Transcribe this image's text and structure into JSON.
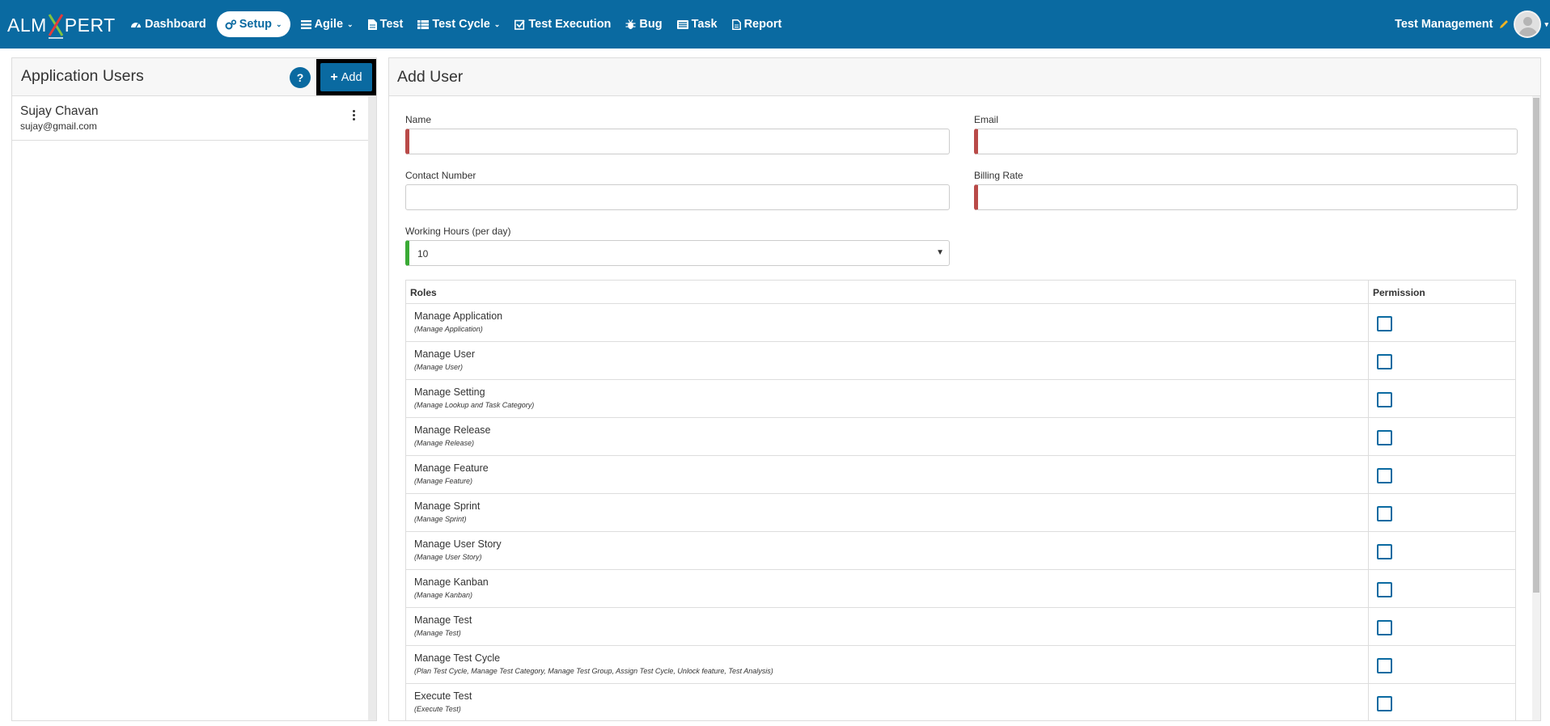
{
  "brand": {
    "prefix": "ALM",
    "suffix": "PERT"
  },
  "nav": [
    {
      "label": "Dashboard",
      "icon": "dashboard-icon"
    },
    {
      "label": "Setup",
      "icon": "cogs-icon",
      "dropdown": true,
      "active": true
    },
    {
      "label": "Agile",
      "icon": "list-icon",
      "dropdown": true
    },
    {
      "label": "Test",
      "icon": "file-icon"
    },
    {
      "label": "Test Cycle",
      "icon": "grid-icon",
      "dropdown": true
    },
    {
      "label": "Test Execution",
      "icon": "check-square-icon"
    },
    {
      "label": "Bug",
      "icon": "bug-icon"
    },
    {
      "label": "Task",
      "icon": "tasks-icon"
    },
    {
      "label": "Report",
      "icon": "report-icon"
    }
  ],
  "header_right": {
    "project": "Test Management"
  },
  "left_panel": {
    "title": "Application Users",
    "help": "?",
    "add_label": "Add",
    "users": [
      {
        "name": "Sujay Chavan",
        "email": "sujay@gmail.com"
      }
    ]
  },
  "form": {
    "title": "Add User",
    "name_label": "Name",
    "name_value": "",
    "email_label": "Email",
    "email_value": "",
    "contact_label": "Contact Number",
    "contact_value": "",
    "billing_label": "Billing Rate",
    "billing_value": "",
    "hours_label": "Working Hours (per day)",
    "hours_value": "10"
  },
  "roles_table": {
    "col_roles": "Roles",
    "col_permission": "Permission",
    "rows": [
      {
        "name": "Manage Application",
        "desc": "(Manage Application)",
        "checked": false
      },
      {
        "name": "Manage User",
        "desc": "(Manage User)",
        "checked": false
      },
      {
        "name": "Manage Setting",
        "desc": "(Manage Lookup and Task Category)",
        "checked": false
      },
      {
        "name": "Manage Release",
        "desc": "(Manage Release)",
        "checked": false
      },
      {
        "name": "Manage Feature",
        "desc": "(Manage Feature)",
        "checked": false
      },
      {
        "name": "Manage Sprint",
        "desc": "(Manage Sprint)",
        "checked": false
      },
      {
        "name": "Manage User Story",
        "desc": "(Manage User Story)",
        "checked": false
      },
      {
        "name": "Manage Kanban",
        "desc": "(Manage Kanban)",
        "checked": false
      },
      {
        "name": "Manage Test",
        "desc": "(Manage Test)",
        "checked": false
      },
      {
        "name": "Manage Test Cycle",
        "desc": "(Plan Test Cycle, Manage Test Category, Manage Test Group, Assign Test Cycle, Unlock feature, Test Analysis)",
        "checked": false
      },
      {
        "name": "Execute Test",
        "desc": "(Execute Test)",
        "checked": false
      }
    ]
  },
  "colors": {
    "primary": "#0a6aa1",
    "required": "#b94a48",
    "valid": "#3aaa35"
  }
}
